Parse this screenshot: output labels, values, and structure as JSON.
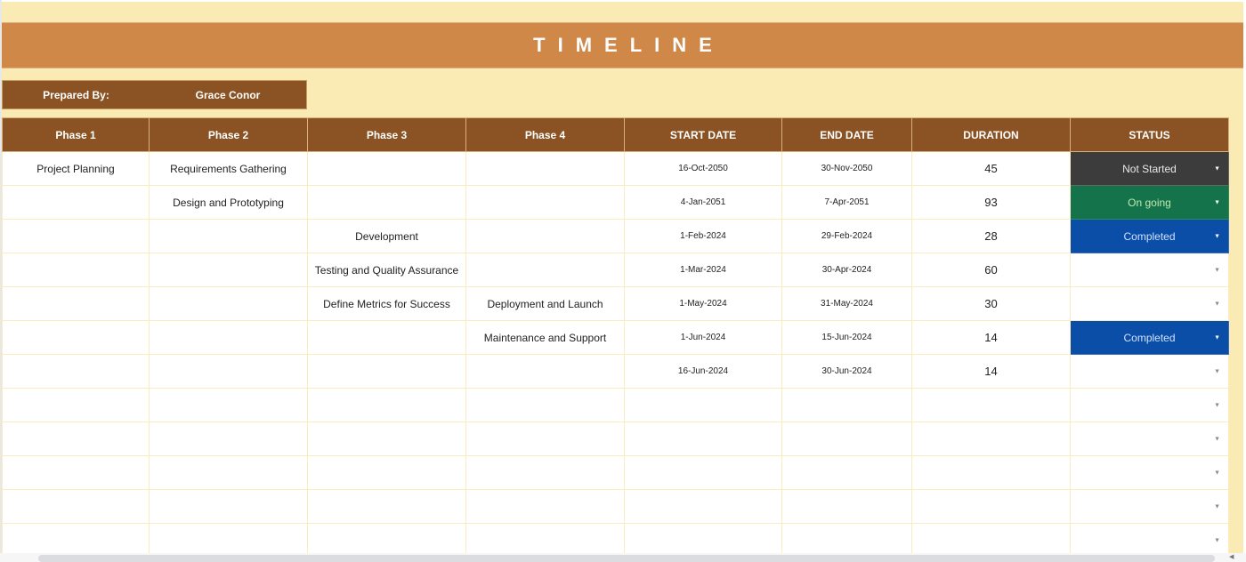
{
  "title": "TIMELINE",
  "prepared_by": {
    "label": "Prepared By:",
    "value": "Grace Conor"
  },
  "columns": [
    "Phase 1",
    "Phase 2",
    "Phase 3",
    "Phase 4",
    "START DATE",
    "END DATE",
    "DURATION",
    "STATUS"
  ],
  "rows": [
    {
      "phase1": "Project Planning",
      "phase2": "Requirements Gathering",
      "phase3": "",
      "phase4": "",
      "start": "16-Oct-2050",
      "end": "30-Nov-2050",
      "duration": "45",
      "status": "Not Started",
      "status_type": "not-started"
    },
    {
      "phase1": "",
      "phase2": "Design and Prototyping",
      "phase3": "",
      "phase4": "",
      "start": "4-Jan-2051",
      "end": "7-Apr-2051",
      "duration": "93",
      "status": "On going",
      "status_type": "ongoing"
    },
    {
      "phase1": "",
      "phase2": "",
      "phase3": "Development",
      "phase4": "",
      "start": "1-Feb-2024",
      "end": "29-Feb-2024",
      "duration": "28",
      "status": "Completed",
      "status_type": "completed"
    },
    {
      "phase1": "",
      "phase2": "",
      "phase3": "Testing and Quality Assurance",
      "phase4": "",
      "start": "1-Mar-2024",
      "end": "30-Apr-2024",
      "duration": "60",
      "status": "",
      "status_type": "empty"
    },
    {
      "phase1": "",
      "phase2": "",
      "phase3": "Define Metrics for Success",
      "phase4": "Deployment and Launch",
      "start": "1-May-2024",
      "end": "31-May-2024",
      "duration": "30",
      "status": "",
      "status_type": "empty"
    },
    {
      "phase1": "",
      "phase2": "",
      "phase3": "",
      "phase4": "Maintenance and Support",
      "start": "1-Jun-2024",
      "end": "15-Jun-2024",
      "duration": "14",
      "status": "Completed",
      "status_type": "completed"
    },
    {
      "phase1": "",
      "phase2": "",
      "phase3": "",
      "phase4": "",
      "start": "16-Jun-2024",
      "end": "30-Jun-2024",
      "duration": "14",
      "status": "",
      "status_type": "empty"
    },
    {
      "phase1": "",
      "phase2": "",
      "phase3": "",
      "phase4": "",
      "start": "",
      "end": "",
      "duration": "",
      "status": "",
      "status_type": "empty"
    },
    {
      "phase1": "",
      "phase2": "",
      "phase3": "",
      "phase4": "",
      "start": "",
      "end": "",
      "duration": "",
      "status": "",
      "status_type": "empty"
    },
    {
      "phase1": "",
      "phase2": "",
      "phase3": "",
      "phase4": "",
      "start": "",
      "end": "",
      "duration": "",
      "status": "",
      "status_type": "empty"
    },
    {
      "phase1": "",
      "phase2": "",
      "phase3": "",
      "phase4": "",
      "start": "",
      "end": "",
      "duration": "",
      "status": "",
      "status_type": "empty"
    },
    {
      "phase1": "",
      "phase2": "",
      "phase3": "",
      "phase4": "",
      "start": "",
      "end": "",
      "duration": "",
      "status": "",
      "status_type": "empty"
    }
  ],
  "icons": {
    "dropdown": "▼",
    "scroll_left": "◀"
  },
  "colors": {
    "background": "#F9EBB3",
    "title_band": "#D08849",
    "header": "#8B5323",
    "grid_line": "#FCEBBE",
    "status_not_started": "#3c3c3c",
    "status_ongoing": "#14734a",
    "status_completed": "#0b4ea8"
  }
}
